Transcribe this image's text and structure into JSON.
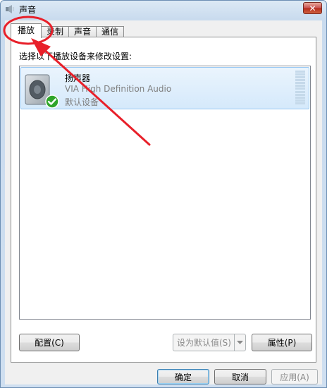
{
  "window": {
    "title": "声音",
    "close_label": "✕",
    "icon": "speaker-icon"
  },
  "tabs": [
    {
      "label": "播放",
      "active": true
    },
    {
      "label": "录制",
      "active": false
    },
    {
      "label": "声音",
      "active": false
    },
    {
      "label": "通信",
      "active": false
    }
  ],
  "panel": {
    "instruction": "选择以下播放设备来修改设置:",
    "devices": [
      {
        "name": "扬声器",
        "driver": "VIA High Definition Audio",
        "status": "默认设备",
        "icon": "speaker-icon",
        "badge": "check-icon"
      }
    ],
    "buttons": {
      "configure": "配置(C)",
      "set_default": "设为默认值(S)",
      "properties": "属性(P)"
    }
  },
  "dialog_buttons": {
    "ok": "确定",
    "cancel": "取消",
    "apply": "应用(A)"
  },
  "colors": {
    "annotation_red": "#e8202a",
    "selection": "#d5e9fb",
    "status_check": "#2fa52a"
  }
}
